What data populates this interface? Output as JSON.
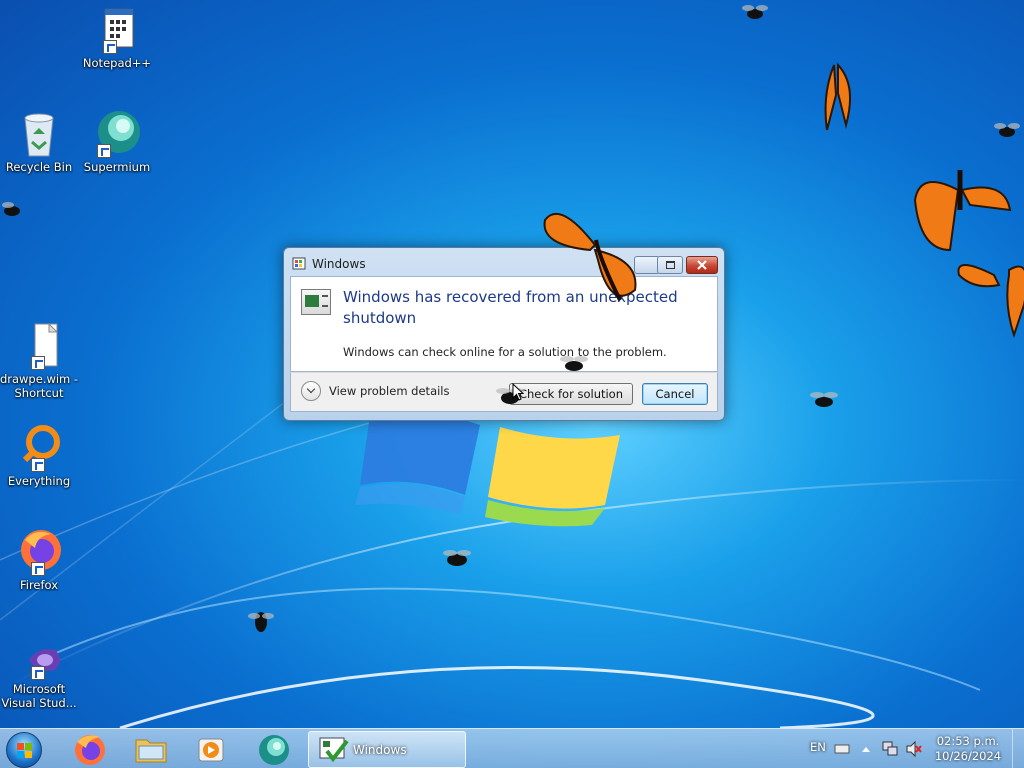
{
  "desktop_icons": [
    {
      "label": "Notepad++",
      "icon": "notepadpp-icon"
    },
    {
      "label": "Recycle Bin",
      "icon": "recycle-bin-icon"
    },
    {
      "label": "Supermium",
      "icon": "supermium-icon"
    },
    {
      "label": "drawpe.wim -\nShortcut",
      "icon": "file-shortcut-icon"
    },
    {
      "label": "Everything",
      "icon": "everything-icon"
    },
    {
      "label": "Firefox",
      "icon": "firefox-icon"
    },
    {
      "label": "Microsoft\nVisual Stud...",
      "icon": "visual-studio-icon"
    }
  ],
  "dialog": {
    "title": "Windows",
    "heading": "Windows has recovered from an unexpected shutdown",
    "message": "Windows can check online for a solution to the problem.",
    "details_label": "View problem details",
    "check_button": "Check for solution",
    "cancel_button": "Cancel"
  },
  "taskbar": {
    "active_window": "Windows",
    "language": "EN",
    "time": "02:53 p.m.",
    "date": "10/26/2024",
    "pinned": [
      "firefox-icon",
      "file-explorer-icon",
      "media-player-icon",
      "supermium-icon"
    ]
  },
  "colors": {
    "heading": "#1c3a8a",
    "wallpaper": "#0a6fd0"
  }
}
